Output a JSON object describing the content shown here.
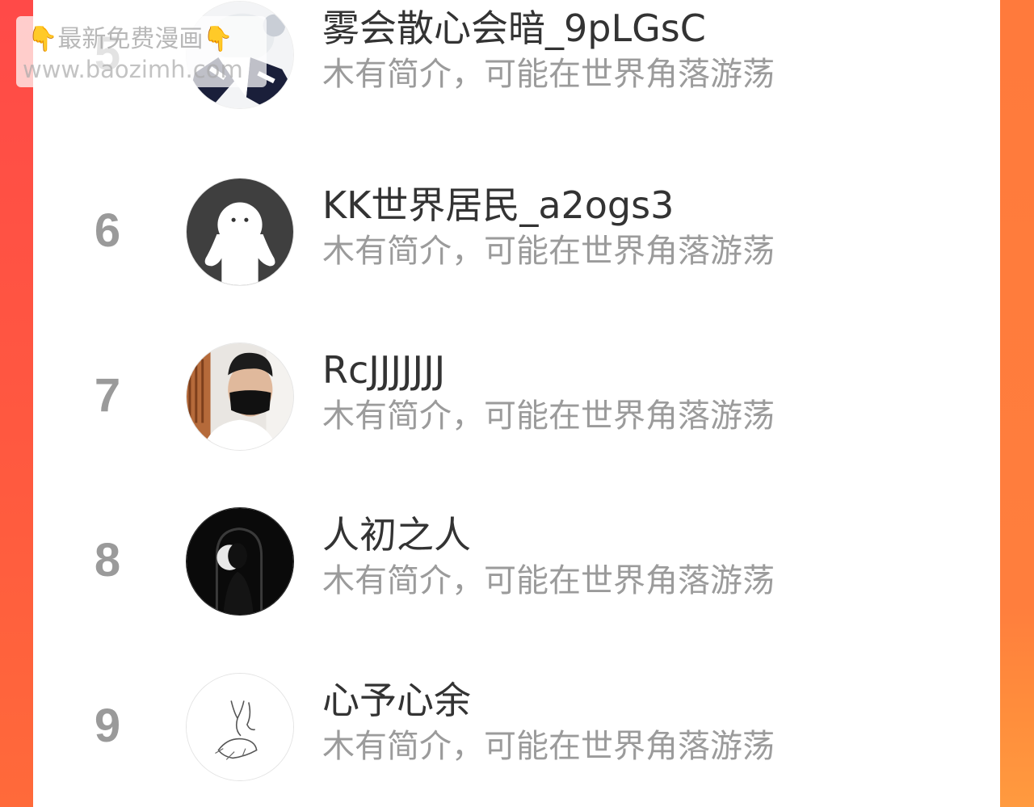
{
  "watermark": {
    "line1_icon": "pointing-down-hand-icon",
    "line1_text": "最新免费漫画",
    "line2_text": "www.baozimh.com"
  },
  "rows": [
    {
      "rank": "5",
      "name": "雾会散心会暗_9pLGsC",
      "intro": "木有简介，可能在世界角落游荡",
      "avatar_icon": "user-photo-avatar"
    },
    {
      "rank": "6",
      "name": "KK世界居民_a2ogs3",
      "intro": "木有简介，可能在世界角落游荡",
      "avatar_icon": "default-ghost-avatar"
    },
    {
      "rank": "7",
      "name": "RcJJJJJJJ",
      "intro": "木有简介，可能在世界角落游荡",
      "avatar_icon": "masked-man-photo-avatar"
    },
    {
      "rank": "8",
      "name": "人初之人",
      "intro": "木有简介，可能在世界角落游荡",
      "avatar_icon": "silhouette-photo-avatar"
    },
    {
      "rank": "9",
      "name": "心予心余",
      "intro": "木有简介，可能在世界角落游荡",
      "avatar_icon": "hand-sketch-avatar"
    }
  ],
  "colors": {
    "side_background": "#ff5a44",
    "rank_text": "#9a9a9a",
    "name_text": "#333333",
    "intro_text": "#9b9b9b"
  }
}
